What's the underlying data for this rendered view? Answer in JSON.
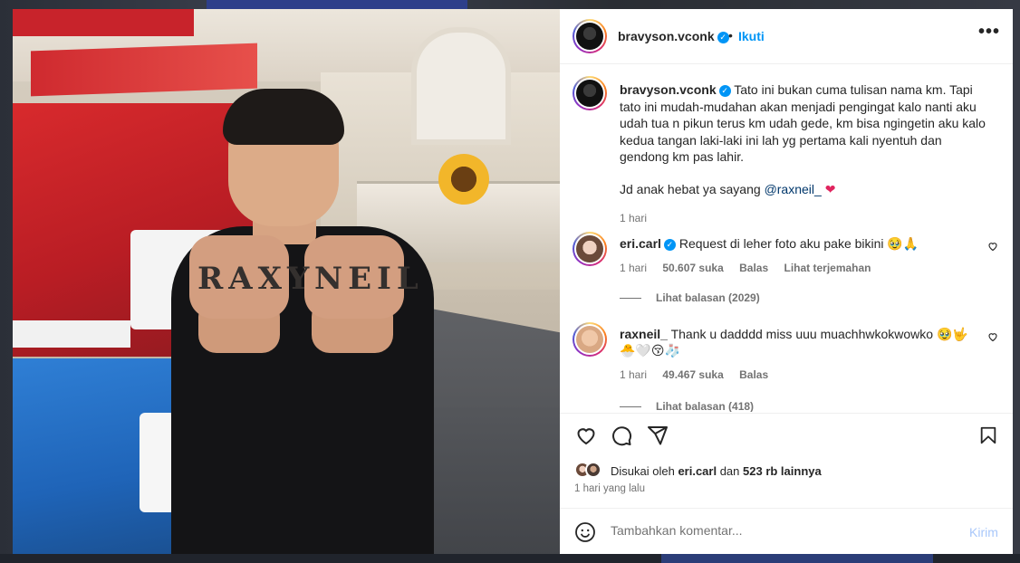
{
  "post": {
    "username": "bravyson.vconk",
    "follow_label": "Ikuti",
    "more_label": "•••",
    "caption_p1": "Tato ini bukan cuma tulisan nama km. Tapi tato ini mudah-mudahan akan menjadi pengingat kalo nanti aku udah tua n pikun terus km udah gede, km bisa ngingetin aku kalo kedua tangan laki-laki ini lah yg pertama kali nyentuh dan gendong km pas lahir.",
    "caption_p2_prefix": "Jd anak hebat ya sayang ",
    "caption_mention": "@raxneil_",
    "caption_heart": "❤",
    "caption_time": "1 hari"
  },
  "photo": {
    "tattoo_left": "RAXY",
    "tattoo_right": "NEIL"
  },
  "comments": [
    {
      "username": "eri.carl",
      "verified": true,
      "text": "Request di leher foto aku pake bikini 🥹🙏",
      "time": "1 hari",
      "likes": "50.607 suka",
      "reply_label": "Balas",
      "translate_label": "Lihat terjemahan",
      "replies_label": "Lihat balasan (2029)"
    },
    {
      "username": "raxneil_",
      "verified": false,
      "text_line1": "Thank u dadddd miss uuu muachhwkokwowko 🥹🤟",
      "text_line2": "🐣🤍😚🧦",
      "time": "1 hari",
      "likes": "49.467 suka",
      "reply_label": "Balas",
      "replies_label": "Lihat balasan (418)"
    }
  ],
  "likes_summary": {
    "prefix": "Disukai oleh ",
    "user": "eri.carl",
    "middle": " dan ",
    "others": "523 rb lainnya"
  },
  "posted_ago": "1 hari yang lalu",
  "comment_box": {
    "placeholder": "Tambahkan komentar...",
    "post_label": "Kirim"
  },
  "icons": [
    "heart-icon",
    "comment-icon",
    "share-icon",
    "bookmark-icon",
    "emoji-icon",
    "more-icon",
    "verified-icon"
  ],
  "colors": {
    "link_blue": "#0095f6",
    "mention": "#00376b",
    "heart": "#e0245e"
  }
}
